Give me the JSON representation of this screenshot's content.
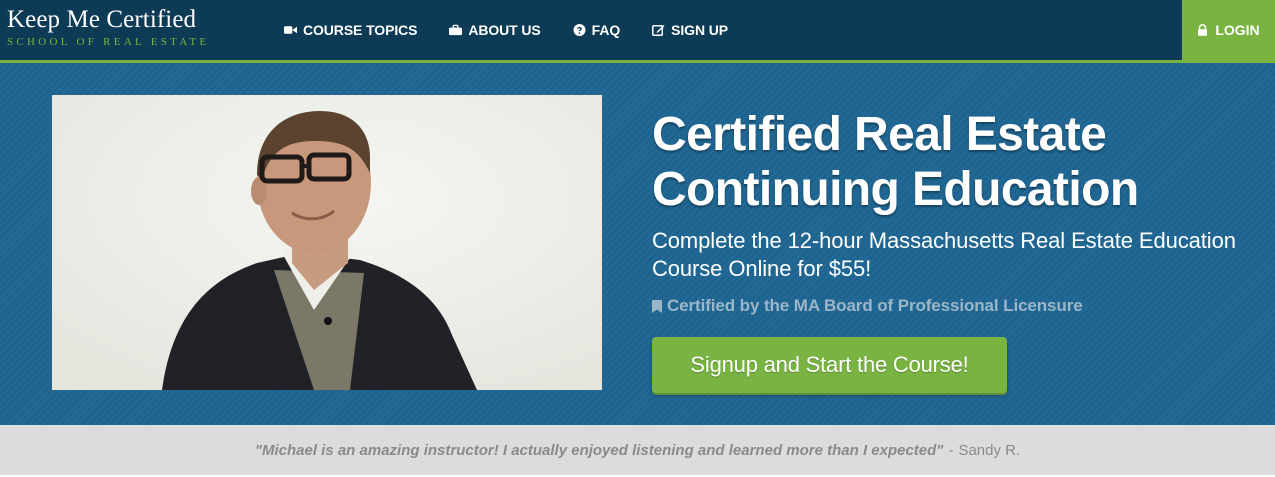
{
  "brand": {
    "name": "Keep Me Certified",
    "tagline": "SCHOOL OF REAL ESTATE"
  },
  "nav": {
    "items": [
      {
        "label": "COURSE TOPICS",
        "icon": "video-camera-icon"
      },
      {
        "label": "ABOUT US",
        "icon": "briefcase-icon"
      },
      {
        "label": "FAQ",
        "icon": "question-circle-icon"
      },
      {
        "label": "SIGN UP",
        "icon": "edit-icon"
      }
    ],
    "login": {
      "label": "LOGIN",
      "icon": "lock-icon"
    }
  },
  "hero": {
    "title": "Certified Real Estate Continuing Education",
    "subtitle": "Complete the 12-hour Massachusetts Real Estate Education Course Online for $55!",
    "certification": "Certified by the MA Board of Professional Licensure",
    "certification_icon": "bookmark-icon",
    "cta_label": "Signup and Start the Course!"
  },
  "testimonial": {
    "quote": "\"Michael is an amazing instructor! I actually enjoyed listening and learned more than I expected\"",
    "separator": "-",
    "author": "Sandy R."
  },
  "colors": {
    "nav_bg": "#0d3a55",
    "accent_green": "#79b442",
    "hero_bg": "#1d6490",
    "testimonial_bg": "#dcdcdc"
  }
}
